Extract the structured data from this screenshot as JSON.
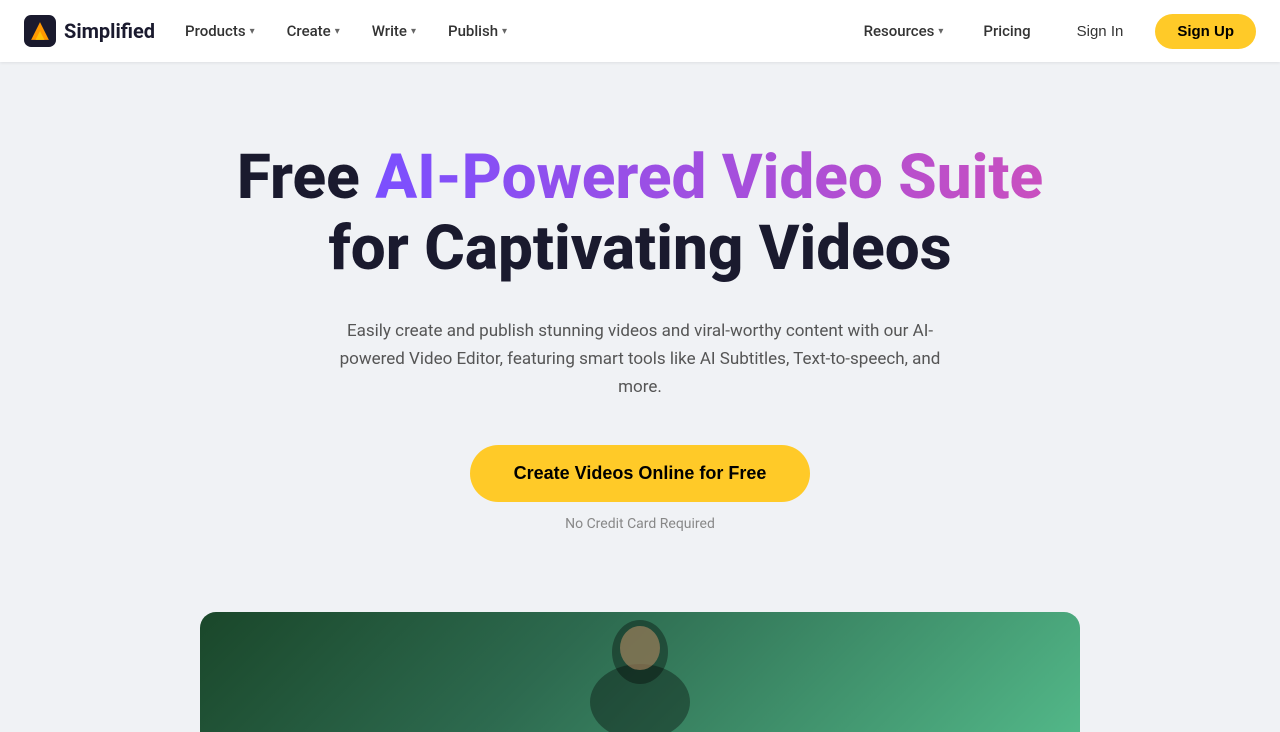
{
  "logo": {
    "text": "Simplified",
    "icon_color_primary": "#FF9800",
    "icon_color_secondary": "#FFC107"
  },
  "nav": {
    "left_items": [
      {
        "label": "Products",
        "has_dropdown": true
      },
      {
        "label": "Create",
        "has_dropdown": true
      },
      {
        "label": "Write",
        "has_dropdown": true
      },
      {
        "label": "Publish",
        "has_dropdown": true
      }
    ],
    "right_items": [
      {
        "label": "Resources",
        "has_dropdown": true
      },
      {
        "label": "Pricing",
        "has_dropdown": false
      }
    ],
    "signin_label": "Sign In",
    "signup_label": "Sign Up"
  },
  "hero": {
    "title_part1": "Free ",
    "title_gradient": "AI-Powered Video Suite",
    "title_part2": " for Captivating Videos",
    "subtitle": "Easily create and publish stunning videos and viral-worthy content with our AI-powered Video Editor, featuring smart tools like AI Subtitles, Text-to-speech, and more.",
    "cta_label": "Create Videos Online for Free",
    "no_card_text": "No Credit Card Required"
  }
}
